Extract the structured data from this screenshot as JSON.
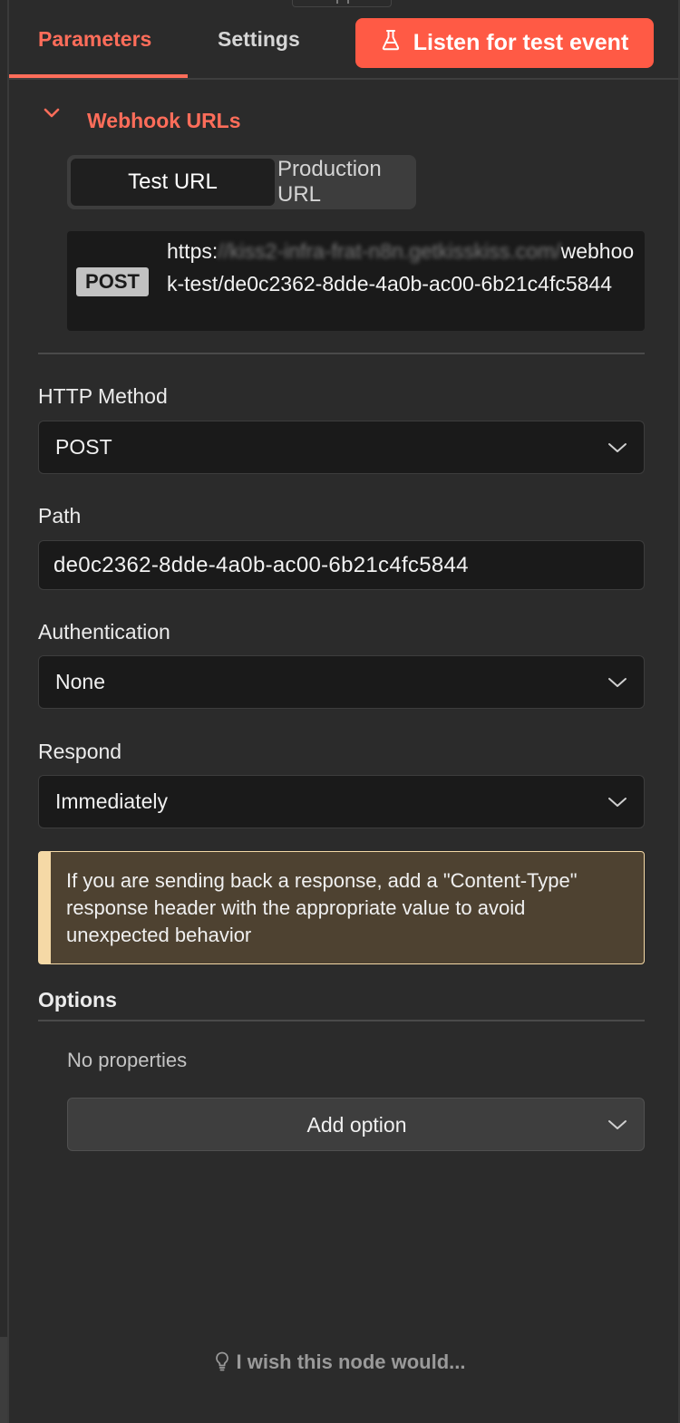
{
  "header": {
    "tabs": [
      {
        "label": "Parameters",
        "active": true
      },
      {
        "label": "Settings",
        "active": false
      }
    ],
    "listen_button": "Listen for test event",
    "listen_icon": "flask-icon"
  },
  "webhook_urls": {
    "title": "Webhook URLs",
    "segments": [
      {
        "label": "Test URL",
        "active": true
      },
      {
        "label": "Production URL",
        "active": false
      }
    ],
    "method": "POST",
    "url_prefix": "https:",
    "url_blurred": "//kiss2-infra-frat-n8n.getkisskiss.com/",
    "url_path": "webhook-test/de0c2362-8dde-4a0b-ac00-6b21c4fc5844"
  },
  "http_method": {
    "label": "HTTP Method",
    "value": "POST"
  },
  "path": {
    "label": "Path",
    "value": "de0c2362-8dde-4a0b-ac00-6b21c4fc5844"
  },
  "authentication": {
    "label": "Authentication",
    "value": "None"
  },
  "respond": {
    "label": "Respond",
    "value": "Immediately"
  },
  "notice": {
    "text": "If you are sending back a response, add a \"Content-Type\" response header with the appropriate value to avoid unexpected behavior"
  },
  "options": {
    "label": "Options",
    "empty_text": "No properties",
    "add_label": "Add option"
  },
  "footer": {
    "wish_text": "I wish this node would..."
  },
  "colors": {
    "accent": "#ff6d5a",
    "button": "#ff5a45",
    "background": "#2b2b2b",
    "input_bg": "#1a1a1a",
    "notice_bg": "#4e4231",
    "notice_border": "#f5d9a6"
  }
}
